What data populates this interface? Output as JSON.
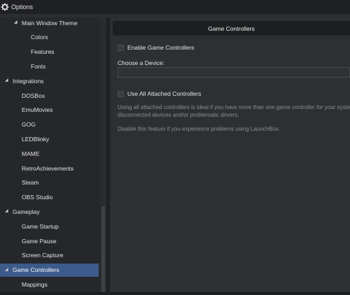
{
  "window": {
    "title": "Options",
    "icon": "gear-icon"
  },
  "sidebar": {
    "items": [
      {
        "label": "Main Window Theme",
        "level": 1,
        "expanded": true,
        "selected": false
      },
      {
        "label": "Colors",
        "level": 2,
        "selected": false
      },
      {
        "label": "Features",
        "level": 2,
        "selected": false
      },
      {
        "label": "Fonts",
        "level": 2,
        "selected": false
      },
      {
        "label": "Integrations",
        "level": 0,
        "expanded": true,
        "selected": false
      },
      {
        "label": "DOSBox",
        "level": 1,
        "selected": false
      },
      {
        "label": "EmuMovies",
        "level": 1,
        "selected": false
      },
      {
        "label": "GOG",
        "level": 1,
        "selected": false
      },
      {
        "label": "LEDBlinky",
        "level": 1,
        "selected": false
      },
      {
        "label": "MAME",
        "level": 1,
        "selected": false
      },
      {
        "label": "RetroAchievements",
        "level": 1,
        "selected": false
      },
      {
        "label": "Steam",
        "level": 1,
        "selected": false
      },
      {
        "label": "OBS Studio",
        "level": 1,
        "selected": false
      },
      {
        "label": "Gameplay",
        "level": 0,
        "expanded": true,
        "selected": false
      },
      {
        "label": "Game Startup",
        "level": 1,
        "selected": false
      },
      {
        "label": "Game Pause",
        "level": 1,
        "selected": false
      },
      {
        "label": "Screen Capture",
        "level": 1,
        "selected": false
      },
      {
        "label": "Game Controllers",
        "level": 0,
        "expanded": true,
        "selected": true
      },
      {
        "label": "Mappings",
        "level": 1,
        "selected": false
      }
    ]
  },
  "content": {
    "header": "Game Controllers",
    "enable_label": "Enable Game Controllers",
    "enable_checked": false,
    "choose_device_label": "Choose a Device:",
    "device_value": "",
    "use_all_label": "Use All Attached Controllers",
    "use_all_checked": false,
    "desc_line1": "Using all attached controllers is ideal if you have more than one game controller for your system.",
    "desc_line2": "disconnected devices and/or problematic drivers.",
    "desc_line3": "Disable this feature if you experience problems using LaunchBox."
  },
  "colors": {
    "selection": "#3c5a8a",
    "background": "#2b2d30"
  }
}
